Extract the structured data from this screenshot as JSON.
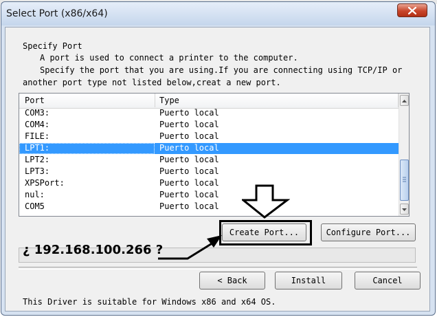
{
  "dialog": {
    "title": "Select Port (x86/x64)",
    "close_icon": "close-x-icon",
    "heading": "Specify Port",
    "desc_line1": "A port is used to connect a printer to the computer.",
    "desc_line2": "Specify the port that you are using.If you are connecting using TCP/IP or",
    "desc_line3": "another port type not listed below,creat a new port."
  },
  "port_list": {
    "columns": [
      "Port",
      "Type"
    ],
    "rows": [
      {
        "port": "COM3:",
        "type": "Puerto local",
        "selected": false
      },
      {
        "port": "COM4:",
        "type": "Puerto local",
        "selected": false
      },
      {
        "port": "FILE:",
        "type": "Puerto local",
        "selected": false
      },
      {
        "port": "LPT1:",
        "type": "Puerto local",
        "selected": true
      },
      {
        "port": "LPT2:",
        "type": "Puerto local",
        "selected": false
      },
      {
        "port": "LPT3:",
        "type": "Puerto local",
        "selected": false
      },
      {
        "port": "XPSPort:",
        "type": "Puerto local",
        "selected": false
      },
      {
        "port": "nul:",
        "type": "Puerto local",
        "selected": false
      },
      {
        "port": "COM5",
        "type": "Puerto local",
        "selected": false
      }
    ]
  },
  "buttons": {
    "create_port": "Create Port...",
    "configure_port": "Configure Port...",
    "back": "< Back",
    "install": "Install",
    "cancel": "Cancel"
  },
  "annotation": {
    "ip_text": "¿ 192.168.100.266 ?",
    "pointer_icon": "down-arrow-outline-icon"
  },
  "footer": {
    "note": "This Driver is suitable for Windows x86 and x64 OS."
  },
  "colors": {
    "selection": "#3399ff",
    "close_button": "#c8462b",
    "titlebar": "#c5d6ec"
  }
}
